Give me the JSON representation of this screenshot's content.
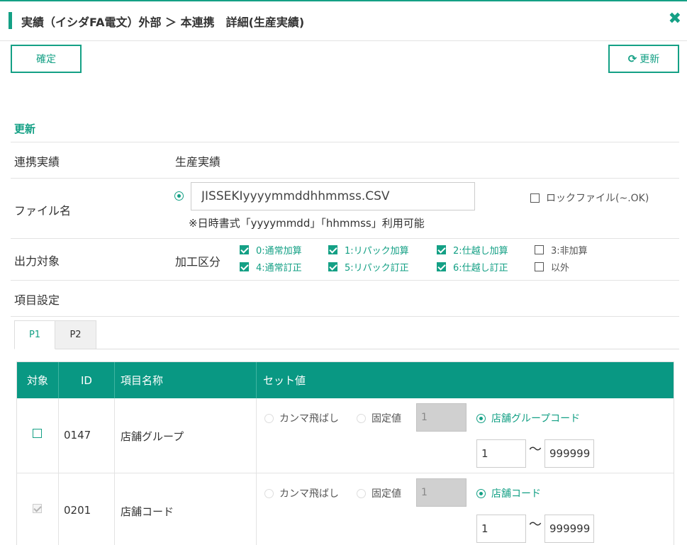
{
  "header": {
    "title": "実績（イシダFA電文）外部 ＞ 本連携　詳細(生産実績)",
    "close_icon": "close-icon"
  },
  "toolbar": {
    "confirm_label": "確定",
    "refresh_label": "更新",
    "refresh_icon": "refresh-icon"
  },
  "section": {
    "title": "更新"
  },
  "form": {
    "link_result_label": "連携実績",
    "link_result_value": "生産実績",
    "filename_label": "ファイル名",
    "filename_value": "JISSEKIyyyymmddhhmmss.CSV",
    "filename_note": "※日時書式「yyyymmdd」「hhmmss」利用可能",
    "lock_file_label": "ロックファイル(~.OK)",
    "output_label": "出力対象",
    "kako_label": "加工区分",
    "kako_options": [
      {
        "label": "0:通常加算",
        "checked": true
      },
      {
        "label": "1:リパック加算",
        "checked": true
      },
      {
        "label": "2:仕越し加算",
        "checked": true
      },
      {
        "label": "3:非加算",
        "checked": false
      },
      {
        "label": "4:通常訂正",
        "checked": true
      },
      {
        "label": "5:リパック訂正",
        "checked": true
      },
      {
        "label": "6:仕越し訂正",
        "checked": true
      },
      {
        "label": "以外",
        "checked": false
      }
    ],
    "item_settings_label": "項目設定"
  },
  "tabs": [
    {
      "label": "P1",
      "active": true
    },
    {
      "label": "P2",
      "active": false
    }
  ],
  "grid": {
    "headers": [
      "対象",
      "ID",
      "項目名称",
      "セット値"
    ],
    "rows": [
      {
        "checked": false,
        "id": "0147",
        "name": "店舗グループ",
        "comma_skip_label": "カンマ飛ばし",
        "fixed_label": "固定値",
        "fixed_value": "1",
        "code_label": "店舗グループコード",
        "range_from": "1",
        "range_tilde": "〜",
        "range_to": "999999"
      },
      {
        "checked": true,
        "id": "0201",
        "name": "店舗コード",
        "comma_skip_label": "カンマ飛ばし",
        "fixed_label": "固定値",
        "fixed_value": "1",
        "code_label": "店舗コード",
        "range_from": "1",
        "range_tilde": "〜",
        "range_to": "999999"
      }
    ]
  },
  "colors": {
    "accent": "#14a085",
    "header_bg": "#099883"
  }
}
